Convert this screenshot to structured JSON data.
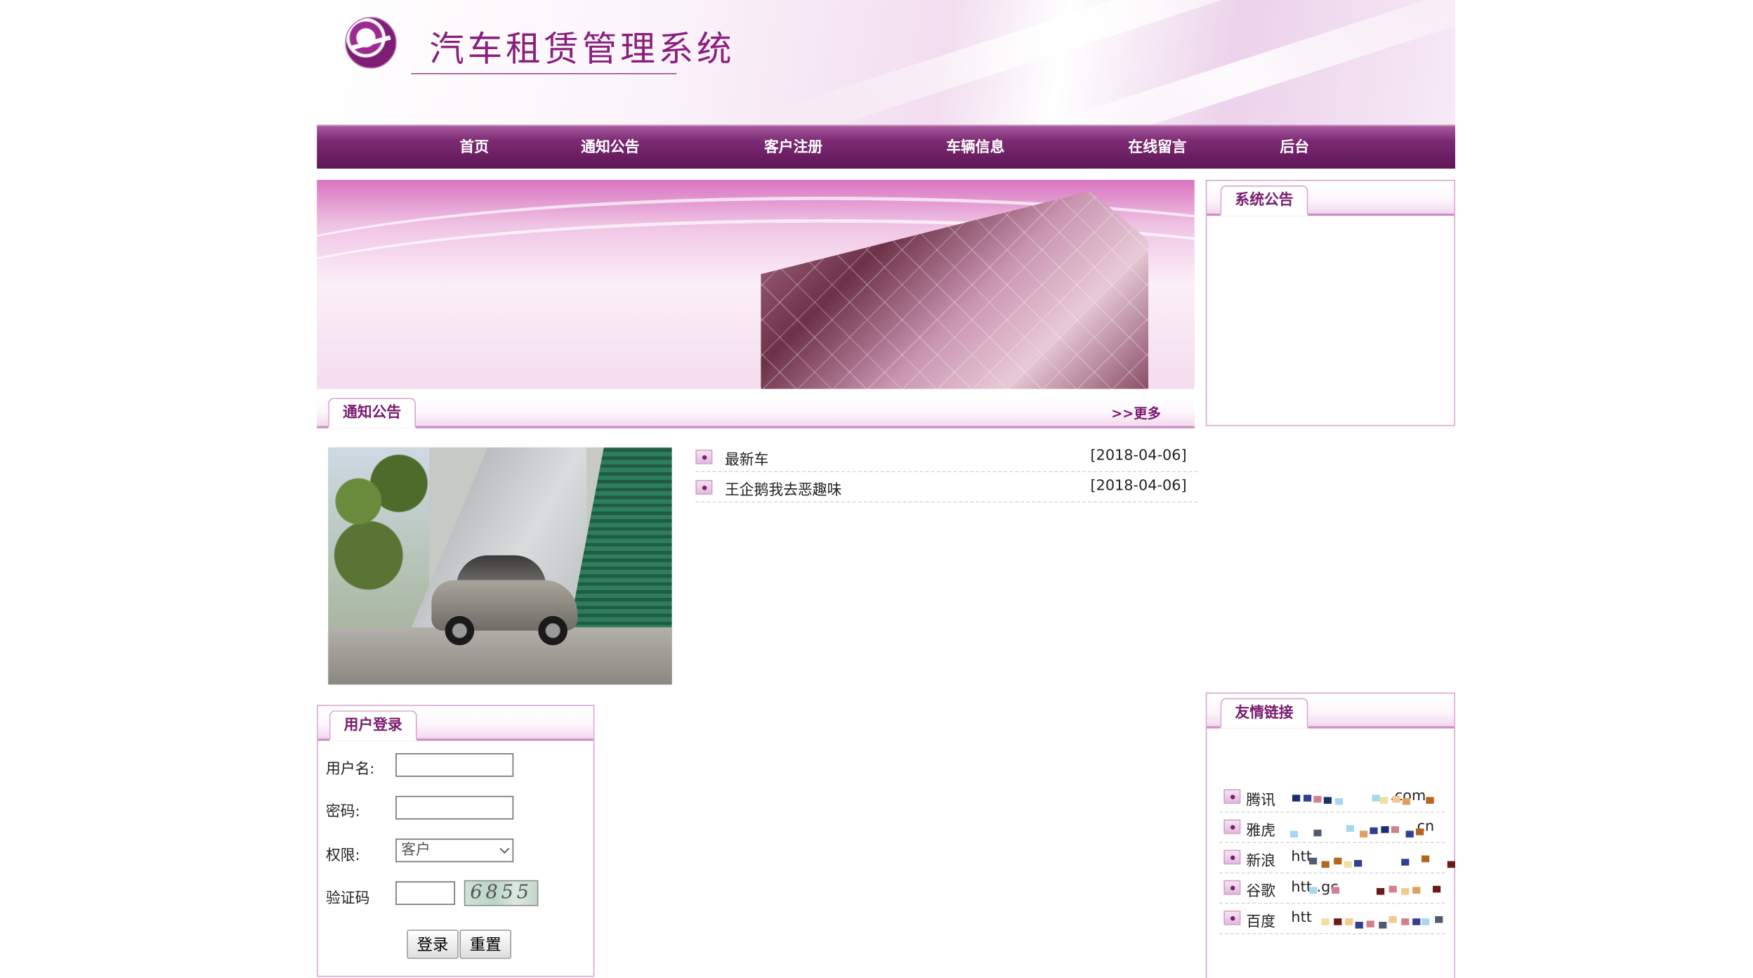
{
  "header": {
    "site_title": "汽车租赁管理系统"
  },
  "nav": {
    "items": [
      {
        "label": "首页"
      },
      {
        "label": "通知公告"
      },
      {
        "label": "客户注册"
      },
      {
        "label": "车辆信息"
      },
      {
        "label": "在线留言"
      },
      {
        "label": "后台"
      }
    ]
  },
  "notices": {
    "tab_label": "通知公告",
    "more_label": ">>更多",
    "items": [
      {
        "title": "最新车",
        "date": "[2018-04-06]"
      },
      {
        "title": "王企鹅我去恶趣味",
        "date": "[2018-04-06]"
      }
    ]
  },
  "system_notice": {
    "tab_label": "系统公告"
  },
  "login": {
    "tab_label": "用户登录",
    "username_label": "用户名:",
    "password_label": "密码:",
    "role_label": "权限:",
    "role_value": "客户",
    "captcha_label": "验证码",
    "captcha_text": "6855",
    "login_button": "登录",
    "reset_button": "重置"
  },
  "links": {
    "tab_label": "友情链接",
    "items": [
      {
        "name": "腾讯",
        "url": ".com"
      },
      {
        "name": "雅虎",
        "url": "cn"
      },
      {
        "name": "新浪",
        "url": "htt"
      },
      {
        "name": "谷歌",
        "url": "htt  .gc"
      },
      {
        "name": "百度",
        "url": "htt"
      }
    ]
  },
  "colors": {
    "brand": "#7a1d70",
    "nav_dark": "#5e1656",
    "border": "#d8a6d0"
  }
}
